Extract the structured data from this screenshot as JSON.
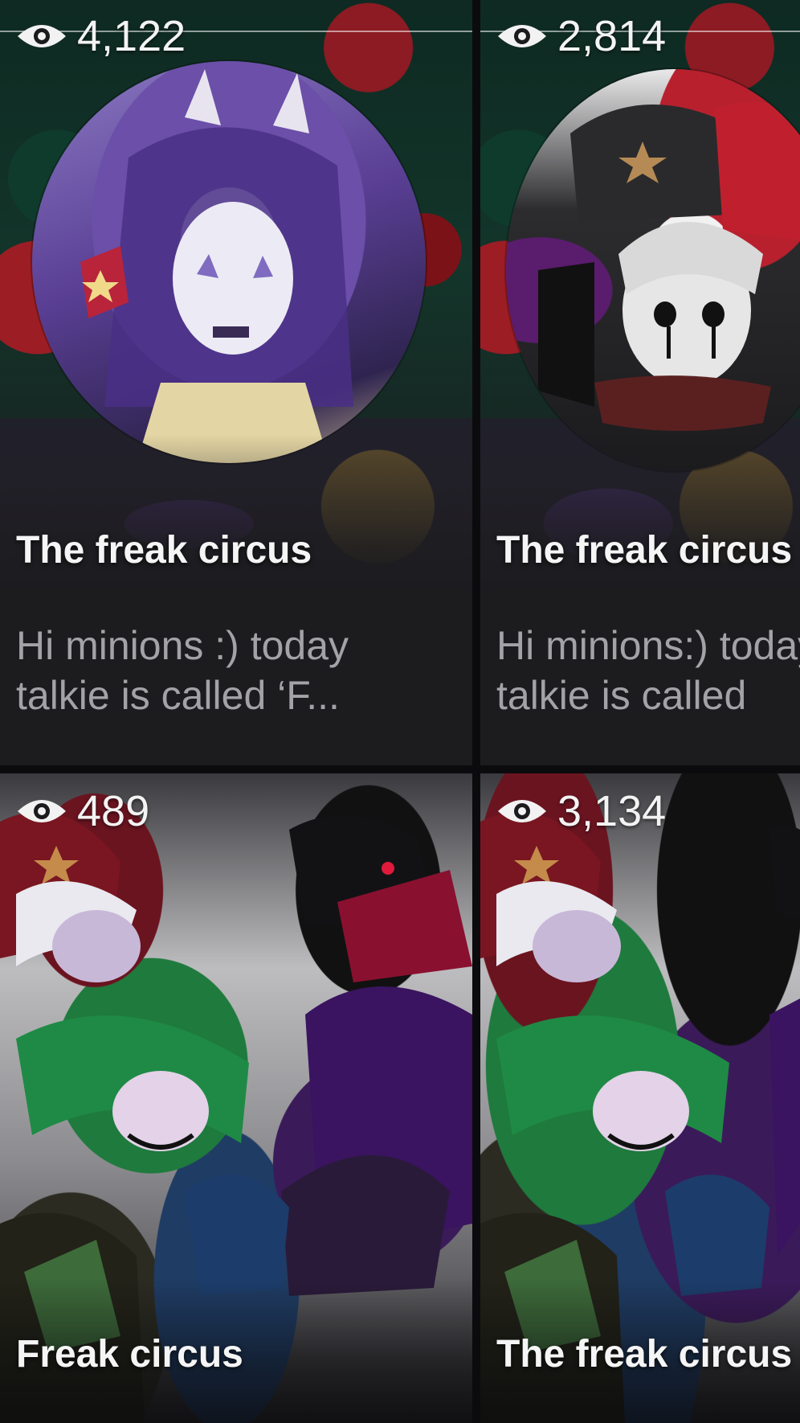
{
  "cards": [
    {
      "views": "4,122",
      "title": "The freak circus",
      "description_line1": "Hi minions :) today",
      "description_line2": "talkie is called ‘F..."
    },
    {
      "views": "2,814",
      "title": "The freak circus",
      "description_line1": "Hi minions:) today",
      "description_line2": "talkie is called"
    },
    {
      "views": "489",
      "title": "Freak circus"
    },
    {
      "views": "3,134",
      "title": "The freak circus"
    }
  ],
  "icons": {
    "views": "eye-icon"
  },
  "colors": {
    "background": "#0b0b0d",
    "card": "#1c1c1f",
    "title_text": "#f5f5f5",
    "description_text": "#a3a3a7"
  }
}
